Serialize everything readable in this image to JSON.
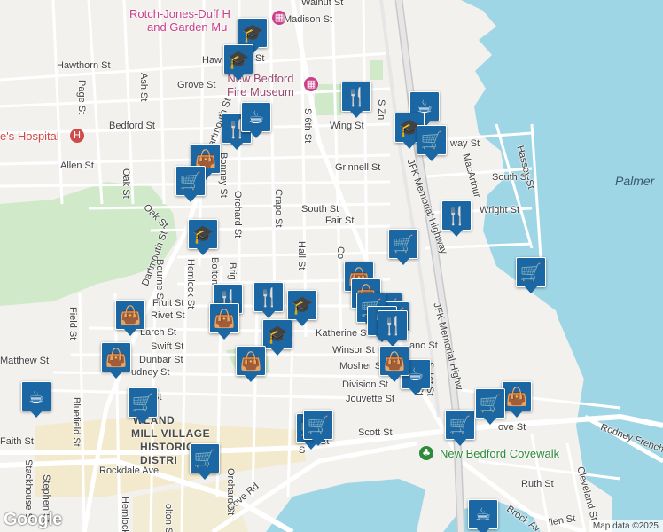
{
  "map": {
    "water_label": "Palmer",
    "attribution": "Map data ©2025",
    "logo": "Google"
  },
  "pois": {
    "rotch": {
      "line1": "Rotch-Jones-Duff H",
      "line2": "and Garden Mu",
      "icon": "museum-icon"
    },
    "fire_museum": {
      "line1": "New Bedford",
      "line2": "Fire Museum",
      "icon": "museum-icon"
    },
    "hospital": {
      "text": "e's Hospital",
      "icon": "hospital-icon"
    },
    "covewalk": {
      "text": "New Bedford Covewalk",
      "icon": "park-icon"
    }
  },
  "district": {
    "line1": "WLAND",
    "line2": "MILL VILLAGE",
    "line3": "HISTORIC",
    "line4": "DISTRI"
  },
  "streets": [
    {
      "id": "walnut",
      "text": "Walnut St"
    },
    {
      "id": "madison",
      "text": "Madison St"
    },
    {
      "id": "hawthorn",
      "text": "Hawthorn St"
    },
    {
      "id": "haw2",
      "text": "Haw"
    },
    {
      "id": "haw3",
      "text": "St"
    },
    {
      "id": "page",
      "text": "Page St"
    },
    {
      "id": "ash",
      "text": "Ash St"
    },
    {
      "id": "grove1",
      "text": "Grove St"
    },
    {
      "id": "bedford",
      "text": "Bedford St"
    },
    {
      "id": "allen",
      "text": "Allen St"
    },
    {
      "id": "oak1",
      "text": "Oak St"
    },
    {
      "id": "oak2",
      "text": "Oak St"
    },
    {
      "id": "dartmouth1",
      "text": "Dartmouth St"
    },
    {
      "id": "dartmouth2",
      "text": "Dartmouth St"
    },
    {
      "id": "bonney",
      "text": "Bonney St"
    },
    {
      "id": "orchard1",
      "text": "Orchard St"
    },
    {
      "id": "crapo",
      "text": "Crapo St"
    },
    {
      "id": "s6th",
      "text": "S 6th St"
    },
    {
      "id": "wing",
      "text": "Wing St"
    },
    {
      "id": "grinnell",
      "text": "Grinnell St"
    },
    {
      "id": "south1",
      "text": "South St"
    },
    {
      "id": "fair",
      "text": "Fair St"
    },
    {
      "id": "hall",
      "text": "Hall St"
    },
    {
      "id": "szn",
      "text": "S Zn"
    },
    {
      "id": "jfk1",
      "text": "JFK Memorial Highway"
    },
    {
      "id": "macarthur",
      "text": "MacArthur"
    },
    {
      "id": "south2",
      "text": "South St"
    },
    {
      "id": "hassey",
      "text": "Hassey St"
    },
    {
      "id": "wright",
      "text": "Wright St"
    },
    {
      "id": "way",
      "text": "way St"
    },
    {
      "id": "bourne",
      "text": "Bourne St"
    },
    {
      "id": "hemlock",
      "text": "Hemlock St"
    },
    {
      "id": "bolton1",
      "text": "Bolton"
    },
    {
      "id": "brig",
      "text": "Brig"
    },
    {
      "id": "fruit",
      "text": "Fruit St"
    },
    {
      "id": "rivet",
      "text": "Rivet St"
    },
    {
      "id": "larch",
      "text": "Larch St"
    },
    {
      "id": "field",
      "text": "Field St"
    },
    {
      "id": "swift",
      "text": "Swift St"
    },
    {
      "id": "dunbar",
      "text": "Dunbar St"
    },
    {
      "id": "matthew",
      "text": "Matthew St"
    },
    {
      "id": "cudney",
      "text": "udney St"
    },
    {
      "id": "estreet",
      "text": "e St"
    },
    {
      "id": "sw",
      "text": "Sw"
    },
    {
      "id": "katherine",
      "text": "Katherine St"
    },
    {
      "id": "winsor",
      "text": "Winsor St"
    },
    {
      "id": "mosher",
      "text": "Mosher S"
    },
    {
      "id": "division",
      "text": "Division St"
    },
    {
      "id": "jouvette",
      "text": "Jouvette St"
    },
    {
      "id": "acush",
      "text": "Acush"
    },
    {
      "id": "co",
      "text": "Co"
    },
    {
      "id": "ano",
      "text": "ano St"
    },
    {
      "id": "s1st",
      "text": "S 1st St"
    },
    {
      "id": "jfk2",
      "text": "JFK Memorial Highw"
    },
    {
      "id": "rdst",
      "text": "rd St"
    },
    {
      "id": "bluefield",
      "text": "Bluefield St"
    },
    {
      "id": "faith",
      "text": "Faith St"
    },
    {
      "id": "stackhouse",
      "text": "Stackhouse St"
    },
    {
      "id": "stephen",
      "text": "Stephen St"
    },
    {
      "id": "rockdale",
      "text": "Rockdale Ave"
    },
    {
      "id": "hemlock2",
      "text": "Hemlock St"
    },
    {
      "id": "bolton2",
      "text": "olton St"
    },
    {
      "id": "orchard2",
      "text": "Orchard St"
    },
    {
      "id": "coverd",
      "text": "Cove Rd"
    },
    {
      "id": "scott",
      "text": "Scott St"
    },
    {
      "id": "ovest",
      "text": "ove St"
    },
    {
      "id": "rodney",
      "text": "Rodney French"
    },
    {
      "id": "ruth",
      "text": "Ruth St"
    },
    {
      "id": "cleveland",
      "text": "Cleveland St"
    },
    {
      "id": "brock",
      "text": "Brock Av"
    },
    {
      "id": "allenst2",
      "text": "llen St"
    },
    {
      "id": "est",
      "text": "e St"
    },
    {
      "id": "s",
      "text": "S"
    },
    {
      "id": "stx",
      "text": "St"
    }
  ],
  "markers": [
    {
      "type": "school",
      "icon": "graduation-cap-icon"
    },
    {
      "type": "school",
      "icon": "graduation-cap-icon"
    },
    {
      "type": "restaurant",
      "icon": "fork-knife-icon"
    },
    {
      "type": "cafe",
      "icon": "coffee-cup-icon"
    },
    {
      "type": "school",
      "icon": "graduation-cap-icon"
    },
    {
      "type": "grocery",
      "icon": "shopping-cart-icon"
    },
    {
      "type": "restaurant",
      "icon": "fork-knife-icon"
    },
    {
      "type": "cafe",
      "icon": "coffee-cup-icon"
    },
    {
      "type": "shop",
      "icon": "shopping-bag-icon"
    },
    {
      "type": "grocery",
      "icon": "shopping-cart-icon"
    },
    {
      "type": "restaurant",
      "icon": "fork-knife-icon"
    },
    {
      "type": "school",
      "icon": "graduation-cap-icon"
    },
    {
      "type": "grocery",
      "icon": "shopping-cart-icon"
    },
    {
      "type": "grocery",
      "icon": "shopping-cart-icon"
    },
    {
      "type": "restaurant",
      "icon": "fork-knife-icon"
    },
    {
      "type": "restaurant",
      "icon": "fork-knife-icon"
    },
    {
      "type": "school",
      "icon": "graduation-cap-icon"
    },
    {
      "type": "shop",
      "icon": "shopping-bag-icon"
    },
    {
      "type": "shop",
      "icon": "shopping-bag-icon"
    },
    {
      "type": "school",
      "icon": "graduation-cap-icon"
    },
    {
      "type": "shop",
      "icon": "shopping-bag-icon"
    },
    {
      "type": "shop",
      "icon": "shopping-bag-icon"
    },
    {
      "type": "shop",
      "icon": "shopping-bag-icon"
    },
    {
      "type": "grocery",
      "icon": "shopping-cart-icon"
    },
    {
      "type": "cafe",
      "icon": "coffee-cup-icon"
    },
    {
      "type": "grocery",
      "icon": "shopping-cart-icon"
    },
    {
      "type": "grocery",
      "icon": "shopping-cart-icon"
    },
    {
      "type": "grocery",
      "icon": "shopping-cart-icon"
    },
    {
      "type": "restaurant",
      "icon": "fork-knife-icon"
    },
    {
      "type": "restaurant",
      "icon": "fork-knife-icon"
    },
    {
      "type": "shop",
      "icon": "shopping-bag-icon"
    },
    {
      "type": "shop",
      "icon": "shopping-bag-icon"
    },
    {
      "type": "cafe",
      "icon": "coffee-cup-icon"
    },
    {
      "type": "grocery",
      "icon": "shopping-cart-icon"
    },
    {
      "type": "shop",
      "icon": "shopping-bag-icon"
    },
    {
      "type": "grocery",
      "icon": "shopping-cart-icon"
    },
    {
      "type": "cafe",
      "icon": "coffee-cup-icon"
    },
    {
      "type": "grocery",
      "icon": "shopping-cart-icon"
    },
    {
      "type": "grocery",
      "icon": "shopping-cart-icon"
    },
    {
      "type": "grocery",
      "icon": "shopping-cart-icon"
    }
  ],
  "icons": {
    "graduation-cap-icon": "🎓",
    "fork-knife-icon": "🍴",
    "coffee-cup-icon": "☕",
    "shopping-cart-icon": "🛒",
    "shopping-bag-icon": "👜"
  },
  "colors": {
    "marker": "#1a67a3",
    "water": "#9fd6e6",
    "park": "#cfe9c9",
    "road": "#ffffff",
    "highway": "#d6d6d6",
    "land": "#f2f1ee"
  }
}
